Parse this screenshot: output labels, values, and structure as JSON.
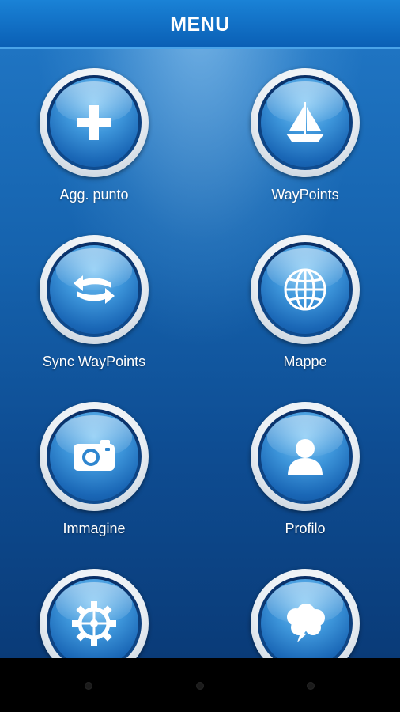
{
  "header": {
    "title": "MENU"
  },
  "menu": {
    "items": [
      {
        "label": "Agg. punto",
        "icon": "plus-icon"
      },
      {
        "label": "WayPoints",
        "icon": "sailboat-icon"
      },
      {
        "label": "Sync WayPoints",
        "icon": "sync-arrows-icon"
      },
      {
        "label": "Mappe",
        "icon": "globe-icon"
      },
      {
        "label": "Immagine",
        "icon": "camera-icon"
      },
      {
        "label": "Profilo",
        "icon": "user-icon"
      },
      {
        "label": "",
        "icon": "gear-icon"
      },
      {
        "label": "",
        "icon": "chat-bubble-icon"
      }
    ]
  },
  "nav": {
    "buttons": [
      "back-button",
      "home-button",
      "recents-button"
    ]
  },
  "colors": {
    "header": "#0a6cc4",
    "accent": "#3d95da",
    "background": "#0e4d93"
  }
}
